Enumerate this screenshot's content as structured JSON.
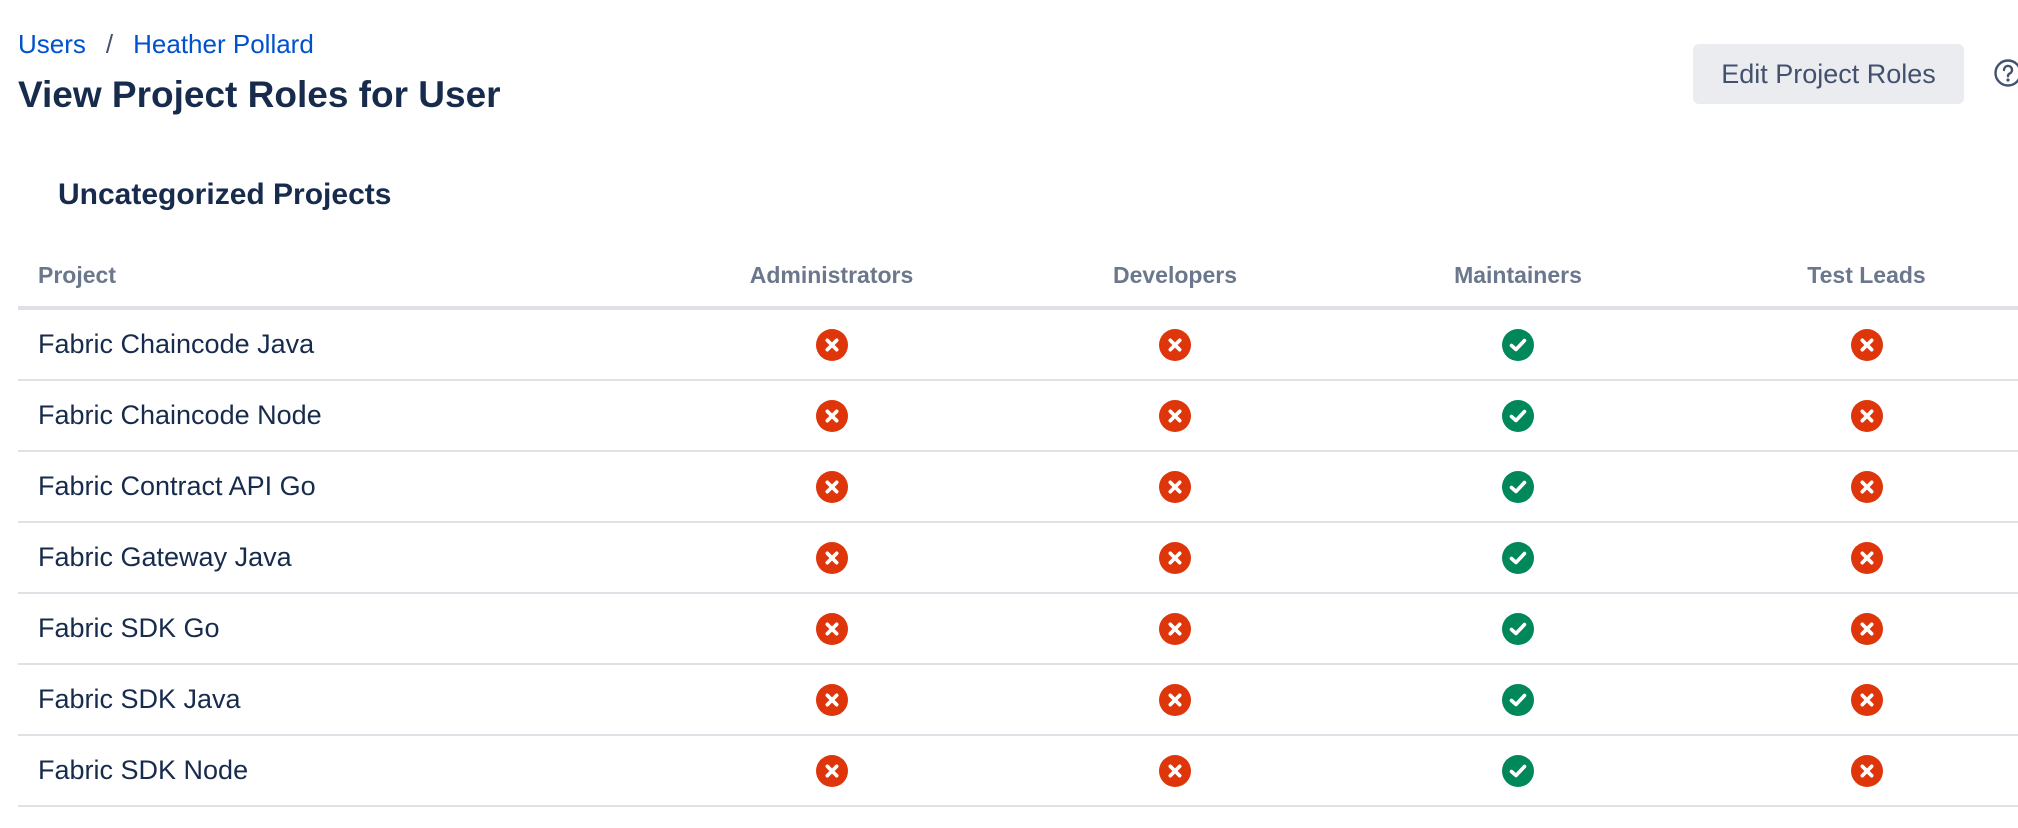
{
  "breadcrumb": {
    "users": "Users",
    "separator": "/",
    "user": "Heather Pollard"
  },
  "page_title": "View Project Roles for User",
  "edit_button": "Edit Project Roles",
  "help_icon": "question-circle-icon",
  "section_title": "Uncategorized Projects",
  "table": {
    "columns": [
      "Project",
      "Administrators",
      "Developers",
      "Maintainers",
      "Test Leads"
    ],
    "rows": [
      {
        "project": "Fabric Chaincode Java",
        "roles": [
          false,
          false,
          true,
          false
        ]
      },
      {
        "project": "Fabric Chaincode Node",
        "roles": [
          false,
          false,
          true,
          false
        ]
      },
      {
        "project": "Fabric Contract API Go",
        "roles": [
          false,
          false,
          true,
          false
        ]
      },
      {
        "project": "Fabric Gateway Java",
        "roles": [
          false,
          false,
          true,
          false
        ]
      },
      {
        "project": "Fabric SDK Go",
        "roles": [
          false,
          false,
          true,
          false
        ]
      },
      {
        "project": "Fabric SDK Java",
        "roles": [
          false,
          false,
          true,
          false
        ]
      },
      {
        "project": "Fabric SDK Node",
        "roles": [
          false,
          false,
          true,
          false
        ]
      }
    ]
  },
  "icons": {
    "yes": "check-circle-icon",
    "no": "cross-circle-icon"
  },
  "colors": {
    "link": "#0052cc",
    "yes": "#00875a",
    "no": "#de350b",
    "heading": "#172b4d",
    "column_header": "#6b778c",
    "button_bg": "#ebecf0"
  }
}
